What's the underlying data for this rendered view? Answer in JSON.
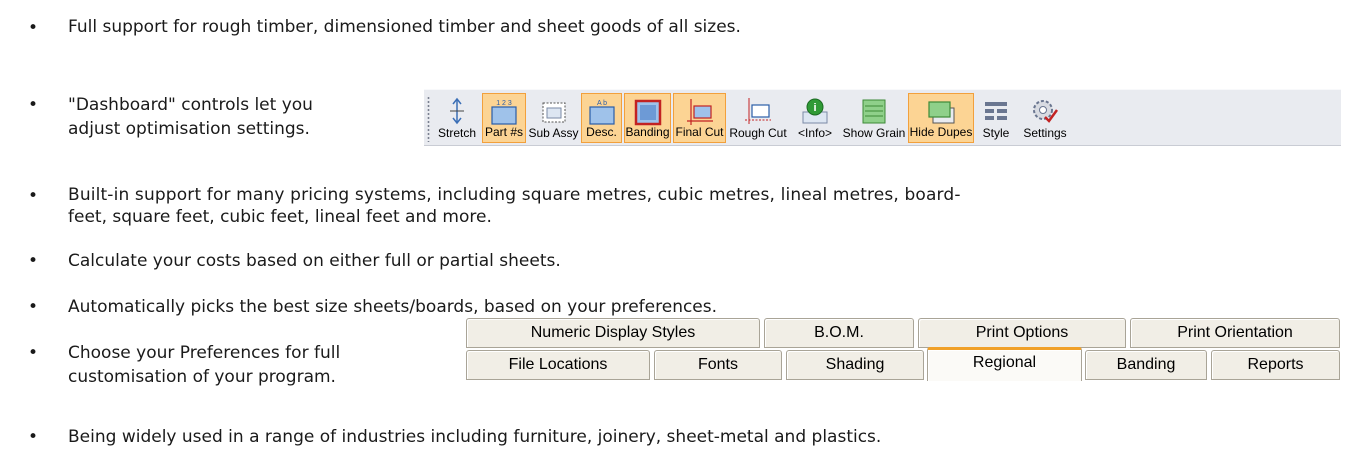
{
  "bullets": [
    "Full support for rough timber, dimensioned timber and sheet goods of all sizes.",
    "\"Dashboard\" controls let you",
    "adjust optimisation settings.",
    "Built-in support for many pricing systems, including square metres, cubic metres, lineal metres, board-",
    "feet, square feet, cubic feet, lineal feet and more.",
    "Calculate your costs based on either full or partial sheets.",
    "Automatically picks the best size sheets/boards, based on your preferences.",
    "Choose your Preferences for full",
    "customisation of your program.",
    "Being widely used in a range of industries including furniture, joinery, sheet-metal and plastics."
  ],
  "bullet_glyph": "•",
  "toolbar": {
    "buttons": [
      {
        "label": "Stretch",
        "icon": "stretch-icon",
        "active": false
      },
      {
        "label": "Part #s",
        "icon": "part-numbers-icon",
        "active": true,
        "icon_text": "1 2 3"
      },
      {
        "label": "Sub Assy",
        "icon": "sub-assembly-icon",
        "active": false
      },
      {
        "label": "Desc.",
        "icon": "description-icon",
        "active": true,
        "icon_text": "A b"
      },
      {
        "label": "Banding",
        "icon": "banding-icon",
        "active": true
      },
      {
        "label": "Final Cut",
        "icon": "final-cut-icon",
        "active": true
      },
      {
        "label": "Rough Cut",
        "icon": "rough-cut-icon",
        "active": false
      },
      {
        "label": "<Info>",
        "icon": "info-icon",
        "active": false
      },
      {
        "label": "Show Grain",
        "icon": "grain-icon",
        "active": false
      },
      {
        "label": "Hide Dupes",
        "icon": "hide-dupes-icon",
        "active": true
      },
      {
        "label": "Style",
        "icon": "style-icon",
        "active": false
      },
      {
        "label": "Settings",
        "icon": "settings-icon",
        "active": false
      }
    ],
    "colors": {
      "active_bg": "#fcd494",
      "active_border": "#f2a03c",
      "bar_bg": "#e9ebf0"
    }
  },
  "tabs": {
    "row1": [
      "Numeric Display Styles",
      "B.O.M.",
      "Print Options",
      "Print Orientation"
    ],
    "row2": [
      "File Locations",
      "Fonts",
      "Shading",
      "Regional",
      "Banding",
      "Reports"
    ],
    "active": "Regional",
    "accent": "#f0a028"
  }
}
